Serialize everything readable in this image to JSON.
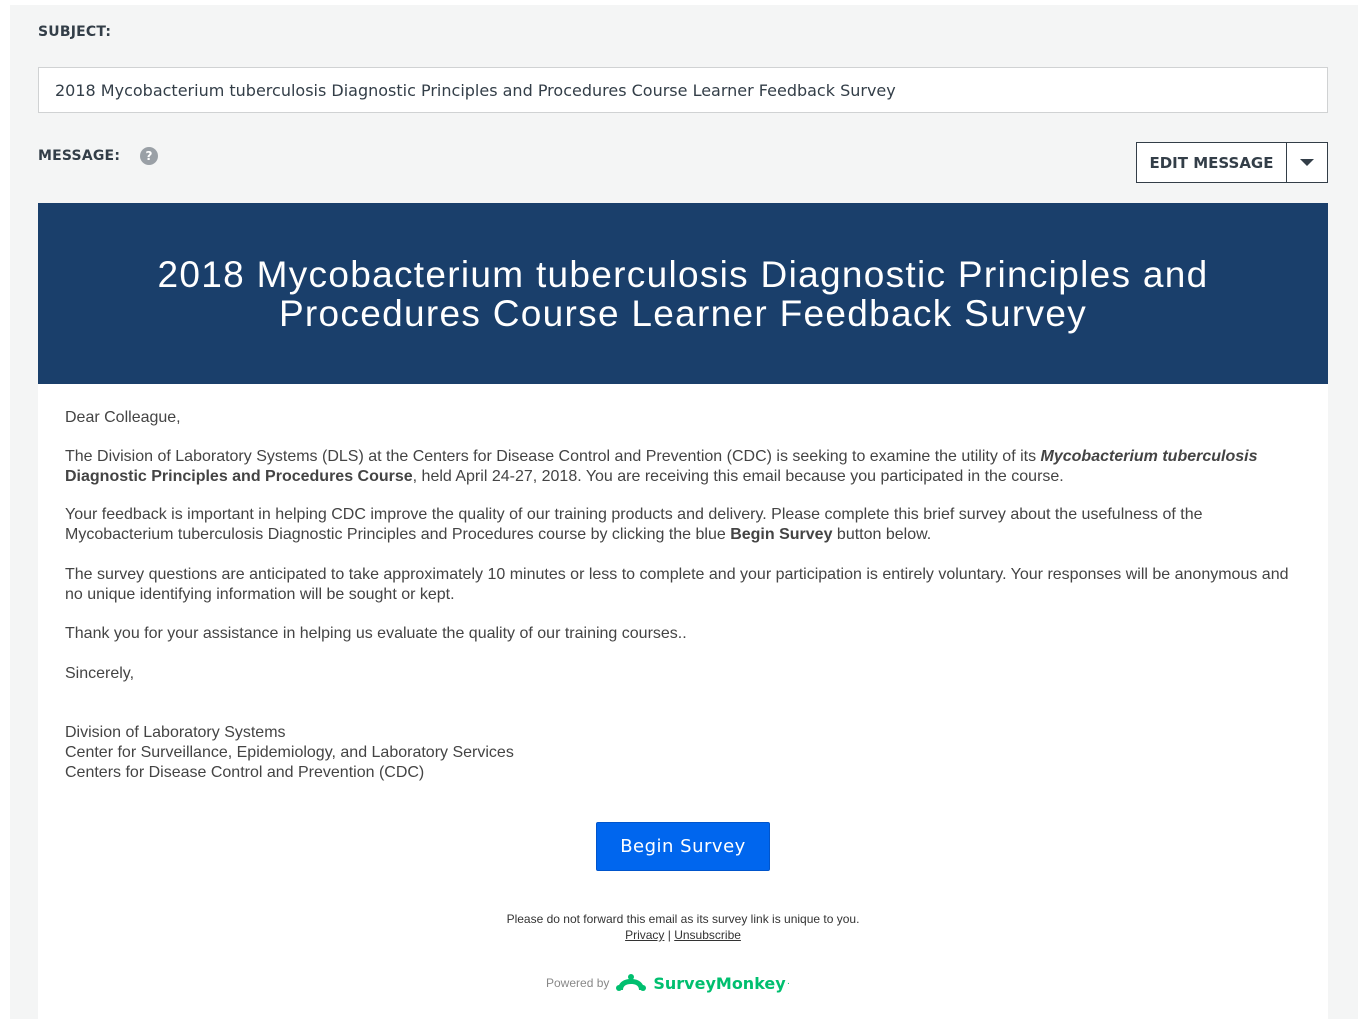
{
  "form": {
    "subject_label": "SUBJECT:",
    "subject_value": "2018 Mycobacterium tuberculosis Diagnostic Principles and Procedures Course Learner Feedback Survey",
    "message_label": "MESSAGE:",
    "help_icon_glyph": "?",
    "edit_message_label": "EDIT MESSAGE"
  },
  "email": {
    "banner_title": "2018 Mycobacterium tuberculosis Diagnostic Principles and Procedures Course Learner Feedback Survey",
    "greeting": "Dear Colleague,",
    "para1_a": "The Division of Laboratory Systems (DLS) at the Centers for Disease Control and Prevention (CDC) is seeking to examine the utility of its ",
    "para1_italic": "Mycobacterium tuberculosis",
    "para1_bold": " Diagnostic Principles and Procedures Course",
    "para1_b": ", held April 24-27, 2018.  You are receiving this email because you participated in the course.",
    "para2_a": "Your feedback is important in helping CDC improve the quality of our training products and delivery. Please complete this brief survey about the usefulness of the Mycobacterium tuberculosis Diagnostic Principles and Procedures course by clicking the blue ",
    "para2_bold": "Begin Survey",
    "para2_b": " button below.",
    "para3": "The survey questions are anticipated to take approximately 10 minutes or less to complete and your participation is entirely voluntary. Your responses will be anonymous and no unique identifying information will be sought or kept.",
    "para4": "Thank you for your assistance in helping us evaluate the quality of our training courses..",
    "closing": "Sincerely,",
    "signature": [
      "Division of Laboratory Systems",
      "Center for Surveillance, Epidemiology, and Laboratory Services",
      "Centers for Disease Control and Prevention (CDC)"
    ],
    "begin_survey_label": "Begin Survey",
    "footer_note": "Please do not forward this email as its survey link is unique to you.",
    "privacy_label": "Privacy",
    "separator": " | ",
    "unsubscribe_label": "Unsubscribe",
    "powered_by": "Powered by",
    "brand_name": "SurveyMonkey",
    "brand_mark": "·"
  },
  "colors": {
    "banner_bg": "#1a3f6b",
    "button_blue": "#0066ee",
    "brand_green": "#00bf6f",
    "panel_bg": "#f4f5f5"
  },
  "icons": {
    "help": "question-circle-icon",
    "caret": "caret-down-icon",
    "logo": "surveymonkey-logo-icon"
  }
}
